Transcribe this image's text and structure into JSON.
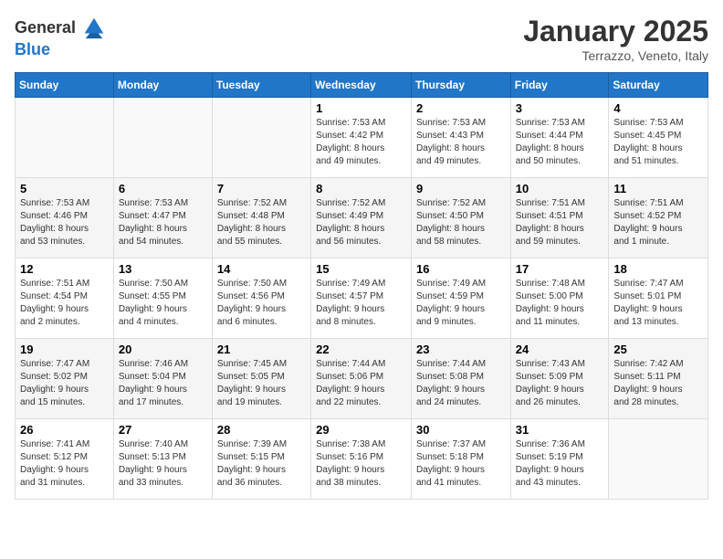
{
  "header": {
    "logo_general": "General",
    "logo_blue": "Blue",
    "month": "January 2025",
    "location": "Terrazzo, Veneto, Italy"
  },
  "days_of_week": [
    "Sunday",
    "Monday",
    "Tuesday",
    "Wednesday",
    "Thursday",
    "Friday",
    "Saturday"
  ],
  "weeks": [
    [
      {
        "day": "",
        "info": ""
      },
      {
        "day": "",
        "info": ""
      },
      {
        "day": "",
        "info": ""
      },
      {
        "day": "1",
        "info": "Sunrise: 7:53 AM\nSunset: 4:42 PM\nDaylight: 8 hours\nand 49 minutes."
      },
      {
        "day": "2",
        "info": "Sunrise: 7:53 AM\nSunset: 4:43 PM\nDaylight: 8 hours\nand 49 minutes."
      },
      {
        "day": "3",
        "info": "Sunrise: 7:53 AM\nSunset: 4:44 PM\nDaylight: 8 hours\nand 50 minutes."
      },
      {
        "day": "4",
        "info": "Sunrise: 7:53 AM\nSunset: 4:45 PM\nDaylight: 8 hours\nand 51 minutes."
      }
    ],
    [
      {
        "day": "5",
        "info": "Sunrise: 7:53 AM\nSunset: 4:46 PM\nDaylight: 8 hours\nand 53 minutes."
      },
      {
        "day": "6",
        "info": "Sunrise: 7:53 AM\nSunset: 4:47 PM\nDaylight: 8 hours\nand 54 minutes."
      },
      {
        "day": "7",
        "info": "Sunrise: 7:52 AM\nSunset: 4:48 PM\nDaylight: 8 hours\nand 55 minutes."
      },
      {
        "day": "8",
        "info": "Sunrise: 7:52 AM\nSunset: 4:49 PM\nDaylight: 8 hours\nand 56 minutes."
      },
      {
        "day": "9",
        "info": "Sunrise: 7:52 AM\nSunset: 4:50 PM\nDaylight: 8 hours\nand 58 minutes."
      },
      {
        "day": "10",
        "info": "Sunrise: 7:51 AM\nSunset: 4:51 PM\nDaylight: 8 hours\nand 59 minutes."
      },
      {
        "day": "11",
        "info": "Sunrise: 7:51 AM\nSunset: 4:52 PM\nDaylight: 9 hours\nand 1 minute."
      }
    ],
    [
      {
        "day": "12",
        "info": "Sunrise: 7:51 AM\nSunset: 4:54 PM\nDaylight: 9 hours\nand 2 minutes."
      },
      {
        "day": "13",
        "info": "Sunrise: 7:50 AM\nSunset: 4:55 PM\nDaylight: 9 hours\nand 4 minutes."
      },
      {
        "day": "14",
        "info": "Sunrise: 7:50 AM\nSunset: 4:56 PM\nDaylight: 9 hours\nand 6 minutes."
      },
      {
        "day": "15",
        "info": "Sunrise: 7:49 AM\nSunset: 4:57 PM\nDaylight: 9 hours\nand 8 minutes."
      },
      {
        "day": "16",
        "info": "Sunrise: 7:49 AM\nSunset: 4:59 PM\nDaylight: 9 hours\nand 9 minutes."
      },
      {
        "day": "17",
        "info": "Sunrise: 7:48 AM\nSunset: 5:00 PM\nDaylight: 9 hours\nand 11 minutes."
      },
      {
        "day": "18",
        "info": "Sunrise: 7:47 AM\nSunset: 5:01 PM\nDaylight: 9 hours\nand 13 minutes."
      }
    ],
    [
      {
        "day": "19",
        "info": "Sunrise: 7:47 AM\nSunset: 5:02 PM\nDaylight: 9 hours\nand 15 minutes."
      },
      {
        "day": "20",
        "info": "Sunrise: 7:46 AM\nSunset: 5:04 PM\nDaylight: 9 hours\nand 17 minutes."
      },
      {
        "day": "21",
        "info": "Sunrise: 7:45 AM\nSunset: 5:05 PM\nDaylight: 9 hours\nand 19 minutes."
      },
      {
        "day": "22",
        "info": "Sunrise: 7:44 AM\nSunset: 5:06 PM\nDaylight: 9 hours\nand 22 minutes."
      },
      {
        "day": "23",
        "info": "Sunrise: 7:44 AM\nSunset: 5:08 PM\nDaylight: 9 hours\nand 24 minutes."
      },
      {
        "day": "24",
        "info": "Sunrise: 7:43 AM\nSunset: 5:09 PM\nDaylight: 9 hours\nand 26 minutes."
      },
      {
        "day": "25",
        "info": "Sunrise: 7:42 AM\nSunset: 5:11 PM\nDaylight: 9 hours\nand 28 minutes."
      }
    ],
    [
      {
        "day": "26",
        "info": "Sunrise: 7:41 AM\nSunset: 5:12 PM\nDaylight: 9 hours\nand 31 minutes."
      },
      {
        "day": "27",
        "info": "Sunrise: 7:40 AM\nSunset: 5:13 PM\nDaylight: 9 hours\nand 33 minutes."
      },
      {
        "day": "28",
        "info": "Sunrise: 7:39 AM\nSunset: 5:15 PM\nDaylight: 9 hours\nand 36 minutes."
      },
      {
        "day": "29",
        "info": "Sunrise: 7:38 AM\nSunset: 5:16 PM\nDaylight: 9 hours\nand 38 minutes."
      },
      {
        "day": "30",
        "info": "Sunrise: 7:37 AM\nSunset: 5:18 PM\nDaylight: 9 hours\nand 41 minutes."
      },
      {
        "day": "31",
        "info": "Sunrise: 7:36 AM\nSunset: 5:19 PM\nDaylight: 9 hours\nand 43 minutes."
      },
      {
        "day": "",
        "info": ""
      }
    ]
  ]
}
